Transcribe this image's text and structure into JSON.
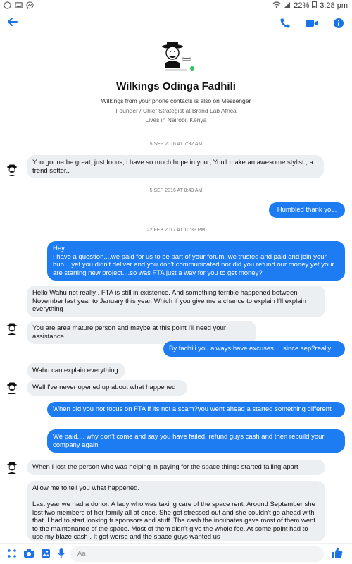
{
  "status": {
    "battery": "22%",
    "time": "3:28 pm"
  },
  "header": {
    "name": "Wilkings Odinga Fadhili",
    "contacts_line": "Wilkings from your phone contacts is also on Messenger",
    "role_line": "Founder / Chief Strategist at Brand  Lab Africa",
    "location_line": "Lives in Nairobi, Kenya"
  },
  "timestamps": [
    "5 SEP 2016 AT 7:32 AM",
    "5 SEP 2016 AT 8:43 AM",
    "22 FEB 2017 AT 10:39 PM"
  ],
  "messages": [
    {
      "from": "them",
      "text": "You gonna be great, just focus, i have so much hope in you , Youll make an awesome stylist , a trend setter.."
    },
    {
      "from": "me",
      "text": "Humbled thank you."
    },
    {
      "from": "me",
      "text": "Hey\nI have a question....we paid for us to be part of your forum, we trusted and paid and join your hub....yet you didn't deliver and you don't communicated nor did you refund our money yet your are starting new project....so was FTA just a way for you to get money?"
    },
    {
      "from": "them",
      "text": "Hello Wahu not really . FTA is still in existence.  And something terrible happened between November last year to January this year.  Which if you give me a chance to explain I'll explain everything"
    },
    {
      "from": "them",
      "text": "You are area mature person and maybe at this point  I'll need your assistance"
    },
    {
      "from": "me",
      "text": "By fadhili you always have excuses.... since sep?really"
    },
    {
      "from": "them",
      "text": "Wahu can explain everything"
    },
    {
      "from": "them",
      "text": "Well I've never opened up about what happened"
    },
    {
      "from": "me",
      "text": "When did you not focus on FTA if its not a scam?you went ahead a started something different"
    },
    {
      "from": "me",
      "text": "We paid.... why don't come and say you have failed, refund guys cash and then rebuild your company again"
    },
    {
      "from": "them",
      "text": "When I lost the person who was helping in paying for the space things started falling apart"
    },
    {
      "from": "them",
      "text": "Allow me to tell you what happened.\n\nLast year we had a donor.  A lady who was taking care of the space rent. Around September she lost two members of her family all at once.  She got stressed out and she couldn't go ahead with that. I had to start looking fr sponsors and stuff.  The cash the incubates gave most of them went to the maintenance of the space.  Most of them didn't give the whole fee. At some point  had to use my blaze cash . It got worse and the space guys wanted us"
    }
  ],
  "composer": {
    "placeholder": "Aa"
  },
  "colors": {
    "accent": "#1e7cf2",
    "incoming_bg": "#eceff1",
    "online": "#31c45c"
  }
}
